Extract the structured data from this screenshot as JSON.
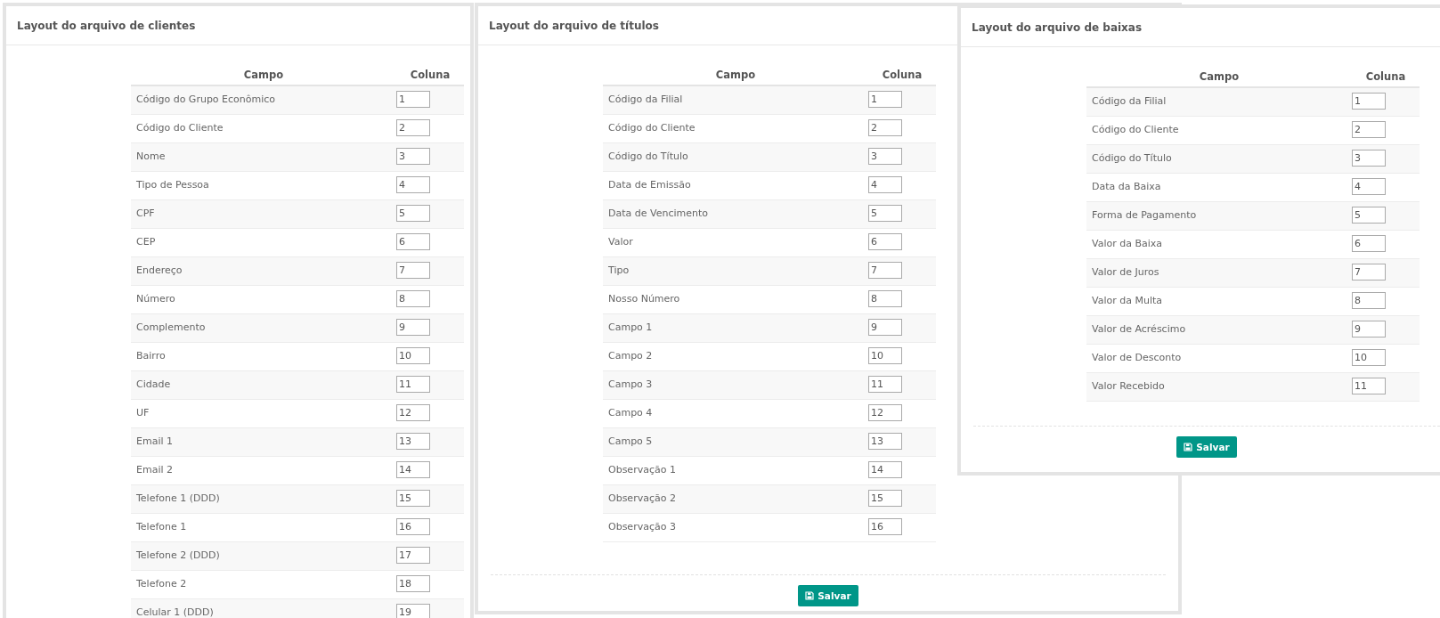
{
  "panels": [
    {
      "title": "Layout do arquivo de clientes",
      "columns": [
        "Campo",
        "Coluna"
      ],
      "rows": [
        {
          "field": "Código do Grupo Econômico",
          "value": "1"
        },
        {
          "field": "Código do Cliente",
          "value": "2"
        },
        {
          "field": "Nome",
          "value": "3"
        },
        {
          "field": "Tipo de Pessoa",
          "value": "4"
        },
        {
          "field": "CPF",
          "value": "5"
        },
        {
          "field": "CEP",
          "value": "6"
        },
        {
          "field": "Endereço",
          "value": "7"
        },
        {
          "field": "Número",
          "value": "8"
        },
        {
          "field": "Complemento",
          "value": "9"
        },
        {
          "field": "Bairro",
          "value": "10"
        },
        {
          "field": "Cidade",
          "value": "11"
        },
        {
          "field": "UF",
          "value": "12"
        },
        {
          "field": "Email 1",
          "value": "13"
        },
        {
          "field": "Email 2",
          "value": "14"
        },
        {
          "field": "Telefone 1 (DDD)",
          "value": "15"
        },
        {
          "field": "Telefone 1",
          "value": "16"
        },
        {
          "field": "Telefone 2 (DDD)",
          "value": "17"
        },
        {
          "field": "Telefone 2",
          "value": "18"
        },
        {
          "field": "Celular 1 (DDD)",
          "value": "19"
        }
      ]
    },
    {
      "title": "Layout do arquivo de títulos",
      "columns": [
        "Campo",
        "Coluna"
      ],
      "rows": [
        {
          "field": "Código da Filial",
          "value": "1"
        },
        {
          "field": "Código do Cliente",
          "value": "2"
        },
        {
          "field": "Código do Título",
          "value": "3"
        },
        {
          "field": "Data de Emissão",
          "value": "4"
        },
        {
          "field": "Data de Vencimento",
          "value": "5"
        },
        {
          "field": "Valor",
          "value": "6"
        },
        {
          "field": "Tipo",
          "value": "7"
        },
        {
          "field": "Nosso Número",
          "value": "8"
        },
        {
          "field": "Campo 1",
          "value": "9"
        },
        {
          "field": "Campo 2",
          "value": "10"
        },
        {
          "field": "Campo 3",
          "value": "11"
        },
        {
          "field": "Campo 4",
          "value": "12"
        },
        {
          "field": "Campo 5",
          "value": "13"
        },
        {
          "field": "Observação 1",
          "value": "14"
        },
        {
          "field": "Observação 2",
          "value": "15"
        },
        {
          "field": "Observação 3",
          "value": "16"
        }
      ],
      "button": "Salvar"
    },
    {
      "title": "Layout do arquivo de baixas",
      "columns": [
        "Campo",
        "Coluna"
      ],
      "rows": [
        {
          "field": "Código da Filial",
          "value": "1"
        },
        {
          "field": "Código do Cliente",
          "value": "2"
        },
        {
          "field": "Código do Título",
          "value": "3"
        },
        {
          "field": "Data da Baixa",
          "value": "4"
        },
        {
          "field": "Forma de Pagamento",
          "value": "5"
        },
        {
          "field": "Valor da Baixa",
          "value": "6"
        },
        {
          "field": "Valor de Juros",
          "value": "7"
        },
        {
          "field": "Valor da Multa",
          "value": "8"
        },
        {
          "field": "Valor de Acréscimo",
          "value": "9"
        },
        {
          "field": "Valor de Desconto",
          "value": "10"
        },
        {
          "field": "Valor Recebido",
          "value": "11"
        }
      ],
      "button": "Salvar"
    }
  ]
}
